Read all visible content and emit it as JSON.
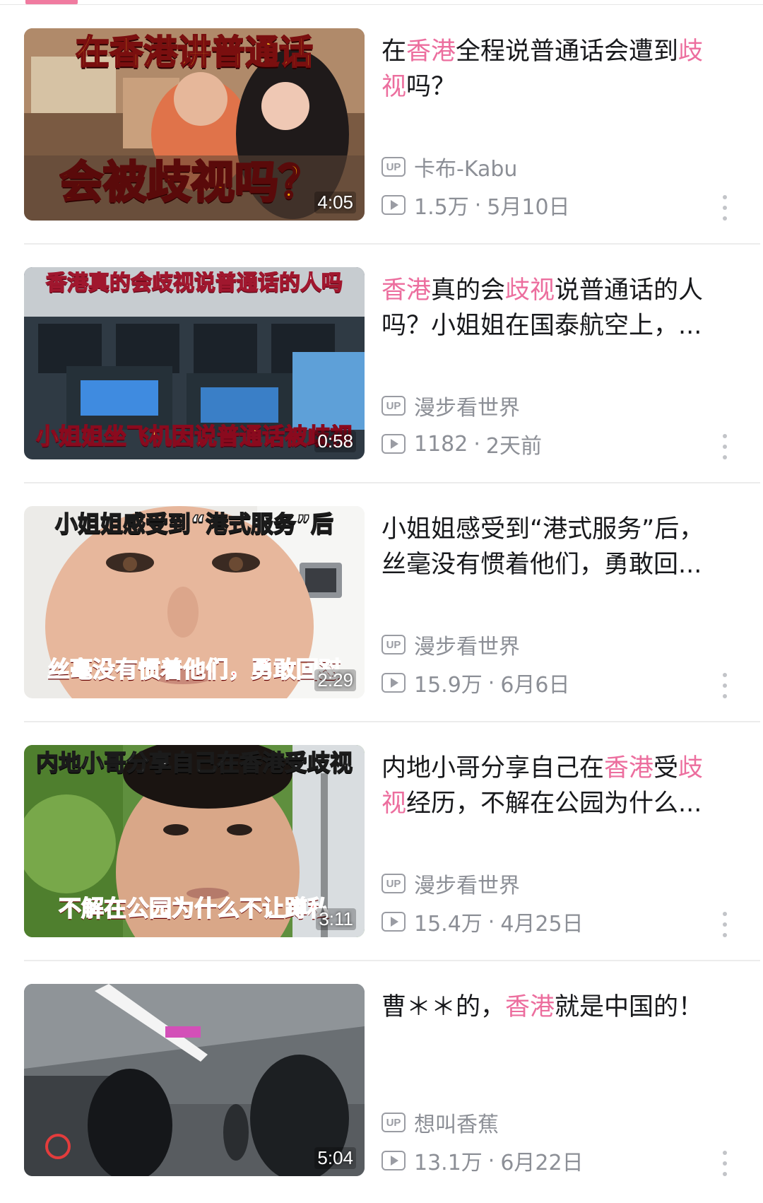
{
  "colors": {
    "accent": "#f07ba0",
    "highlight": "#ec6e9e",
    "meta": "#8c8f96"
  },
  "icons": {
    "up_badge": "up-badge-icon",
    "play_count": "play-count-icon",
    "more": "more-vertical-icon"
  },
  "videos": [
    {
      "title_parts": [
        {
          "text": "在",
          "hl": false
        },
        {
          "text": "香港",
          "hl": true
        },
        {
          "text": "全程说普通话会遭到",
          "hl": false
        },
        {
          "text": "歧视",
          "hl": true
        },
        {
          "text": "吗？",
          "hl": false
        }
      ],
      "up_badge": "UP",
      "author": "卡布-Kabu",
      "views": "1.5万",
      "separator": "·",
      "date": "5月10日",
      "duration": "4:05",
      "thumb_caption_top": "在香港讲普通话",
      "thumb_caption_bottom": "会被歧视吗？"
    },
    {
      "title_parts": [
        {
          "text": "香港",
          "hl": true
        },
        {
          "text": "真的会",
          "hl": false
        },
        {
          "text": "歧视",
          "hl": true
        },
        {
          "text": "说普通话的人吗？小姐姐在国泰航空上，...",
          "hl": false
        }
      ],
      "up_badge": "UP",
      "author": "漫步看世界",
      "views": "1182",
      "separator": "·",
      "date": "2天前",
      "duration": "0:58",
      "thumb_caption_top": "香港真的会歧视说普通话的人吗",
      "thumb_caption_bottom": "小姐姐坐飞机因说普通话被歧视"
    },
    {
      "title_parts": [
        {
          "text": "小姐姐感受到“港式服务”后，丝毫没有惯着他们，勇敢回...",
          "hl": false
        }
      ],
      "up_badge": "UP",
      "author": "漫步看世界",
      "views": "15.9万",
      "separator": "·",
      "date": "6月6日",
      "duration": "2:29",
      "thumb_caption_top": "小姐姐感受到“港式服务”后",
      "thumb_caption_bottom": "丝毫没有惯着他们，勇敢回怼"
    },
    {
      "title_parts": [
        {
          "text": "内地小哥分享自己在",
          "hl": false
        },
        {
          "text": "香港",
          "hl": true
        },
        {
          "text": "受",
          "hl": false
        },
        {
          "text": "歧视",
          "hl": true
        },
        {
          "text": "经历，不解在公园为什么...",
          "hl": false
        }
      ],
      "up_badge": "UP",
      "author": "漫步看世界",
      "views": "15.4万",
      "separator": "·",
      "date": "4月25日",
      "duration": "3:11",
      "thumb_caption_top": "内地小哥分享自己在香港受歧视",
      "thumb_caption_bottom": "不解在公园为什么不让蹲私"
    },
    {
      "title_parts": [
        {
          "text": "曹＊＊的，",
          "hl": false
        },
        {
          "text": "香港",
          "hl": true
        },
        {
          "text": "就是中国的！",
          "hl": false
        }
      ],
      "up_badge": "UP",
      "author": "想叫香蕉",
      "views": "13.1万",
      "separator": "·",
      "date": "6月22日",
      "duration": "5:04",
      "thumb_caption_top": "",
      "thumb_caption_bottom": ""
    }
  ]
}
